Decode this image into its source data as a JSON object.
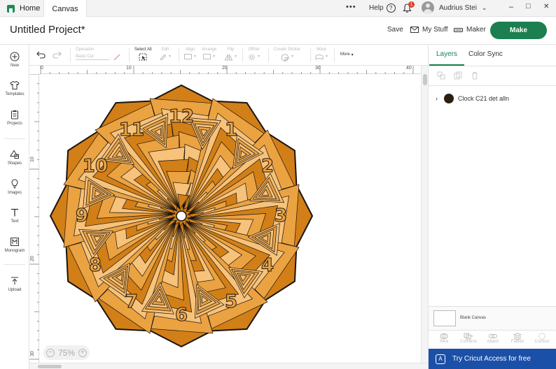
{
  "tabs": {
    "home": "Home",
    "canvas": "Canvas"
  },
  "window": {
    "more": "•••",
    "help": "Help",
    "notif_count": "1",
    "user": "Audrius Stei",
    "minimize": "–",
    "maximize": "□",
    "close": "✕"
  },
  "header": {
    "project_title": "Untitled Project*",
    "save": "Save",
    "my_stuff": "My Stuff",
    "maker": "Maker",
    "make": "Make"
  },
  "sidebar": [
    {
      "id": "new",
      "label": "New"
    },
    {
      "id": "templates",
      "label": "Templates"
    },
    {
      "id": "projects",
      "label": "Projects"
    },
    {
      "id": "shapes",
      "label": "Shapes"
    },
    {
      "id": "images",
      "label": "Images"
    },
    {
      "id": "text",
      "label": "Text"
    },
    {
      "id": "monogram",
      "label": "Monogram"
    },
    {
      "id": "upload",
      "label": "Upload"
    }
  ],
  "toolbar": {
    "operation": "Operation",
    "operation_value": "Basic Cut",
    "select_all": "Select All",
    "edit": "Edit",
    "align": "Align",
    "arrange": "Arrange",
    "flip": "Flip",
    "offset": "Offset",
    "create_sticker": "Create Sticker",
    "warp": "Warp",
    "more": "More"
  },
  "rulers": {
    "top": [
      "0",
      "10",
      "20",
      "30",
      "40"
    ],
    "left": [
      "10",
      "20",
      "30"
    ]
  },
  "zoom": {
    "value": "75%",
    "minus": "−",
    "plus": "+"
  },
  "panel": {
    "tab_layers": "Layers",
    "tab_color_sync": "Color Sync",
    "layer_name": "Clock C21 det alln",
    "blank_canvas": "Blank Canvas",
    "tools": [
      "Slice",
      "Combine",
      "Attach",
      "Flatten",
      "Contour"
    ],
    "banner": "Try Cricut Access for free"
  },
  "design": {
    "numbers": [
      "12",
      "1",
      "2",
      "3",
      "4",
      "5",
      "6",
      "7",
      "8",
      "9",
      "10",
      "11"
    ],
    "colors": {
      "light": "#f7c27a",
      "mid": "#eba241",
      "dark": "#d27f17",
      "outline": "#1a1410"
    }
  },
  "colors": {
    "accent": "#1b7f4f",
    "banner": "#1b50a8"
  }
}
